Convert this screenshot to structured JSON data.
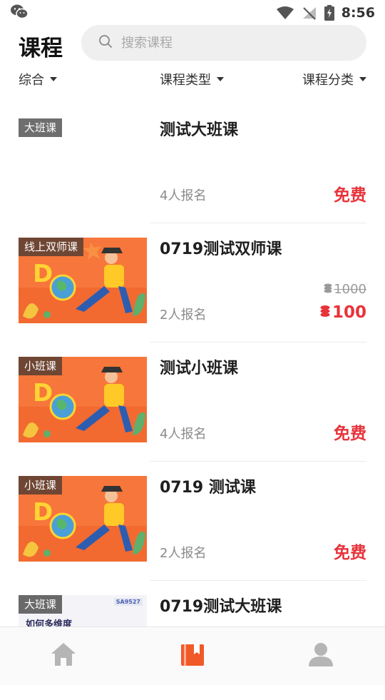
{
  "status": {
    "time": "8:56"
  },
  "header": {
    "title": "课程",
    "search_placeholder": "搜索课程"
  },
  "filters": {
    "sort": "综合",
    "course_type": "课程类型",
    "category": "课程分类"
  },
  "courses": [
    {
      "tag": "大班课",
      "title": "测试大班课",
      "enroll": "4人报名",
      "price": "免费",
      "has_image": false
    },
    {
      "tag": "线上双师课",
      "title": "0719测试双师课",
      "enroll": "2人报名",
      "price": "100",
      "old_price": "1000",
      "has_image": true
    },
    {
      "tag": "小班课",
      "title": "测试小班课",
      "enroll": "4人报名",
      "price": "免费",
      "has_image": true
    },
    {
      "tag": "小班课",
      "title": "0719 测试课",
      "enroll": "2人报名",
      "price": "免费",
      "has_image": true
    },
    {
      "tag": "大班课",
      "title": "0719测试大班课",
      "thumb_text": "如何多维度",
      "thumb_badge": "SA9527",
      "has_image": true
    }
  ],
  "colors": {
    "accent": "#f05a28",
    "price": "#e8333a",
    "tab_inactive": "#b5b5b5"
  },
  "tabs": [
    {
      "icon": "home-icon",
      "active": false
    },
    {
      "icon": "book-icon",
      "active": true
    },
    {
      "icon": "profile-icon",
      "active": false
    }
  ]
}
